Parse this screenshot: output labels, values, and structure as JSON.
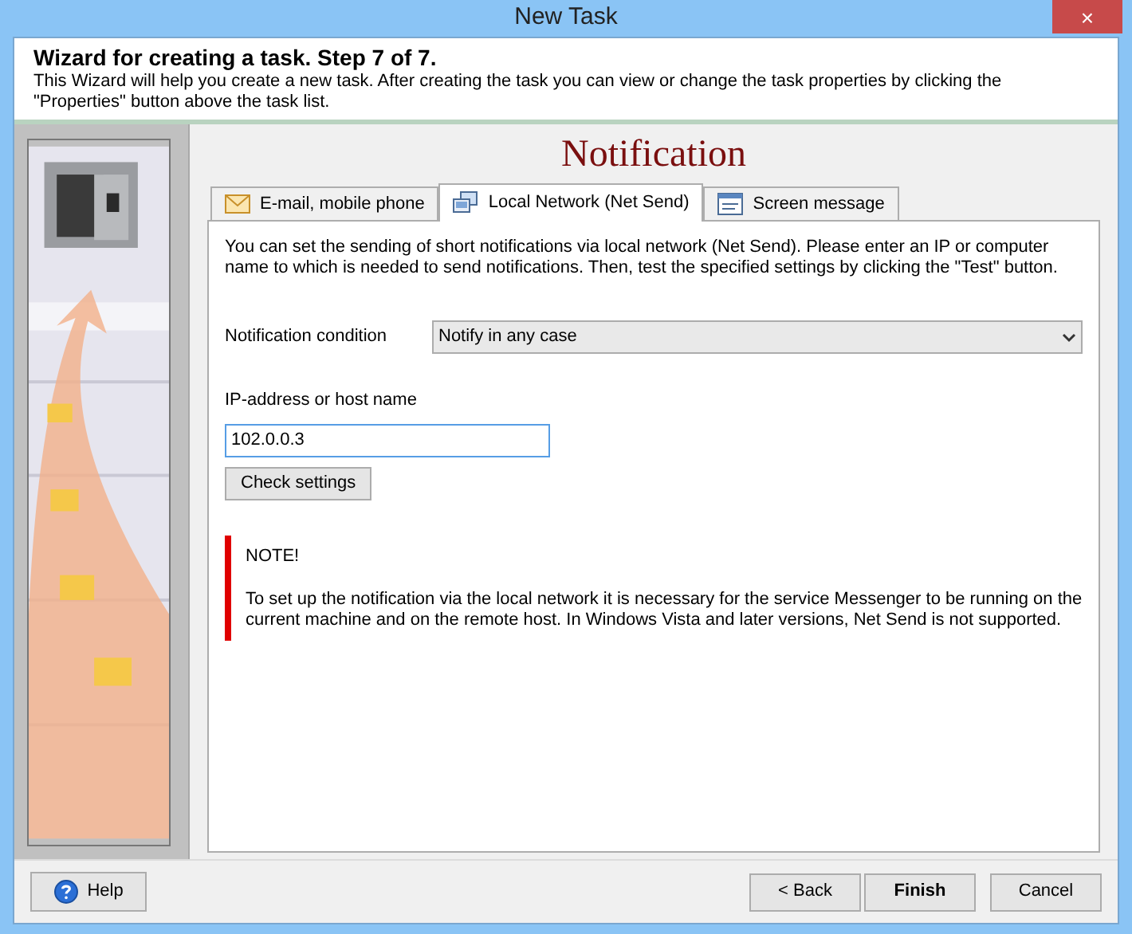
{
  "window": {
    "title": "New Task",
    "close": "×"
  },
  "header": {
    "title": "Wizard for creating a task. Step 7 of 7.",
    "description": "This Wizard will help you create a new task. After creating the task you can view or change the task properties by clicking the \"Properties\" button above the task list."
  },
  "page_title": "Notification",
  "tabs": [
    {
      "label": "E-mail, mobile phone",
      "selected": false
    },
    {
      "label": "Local Network (Net Send)",
      "selected": true
    },
    {
      "label": "Screen message",
      "selected": false
    }
  ],
  "intro": "You can set the sending of short notifications via local network (Net Send). Please enter an IP or computer name to which is needed to send notifications. Then, test the specified settings by clicking the \"Test\" button.",
  "condition": {
    "label": "Notification condition",
    "value": "Notify in any case"
  },
  "host": {
    "label": "IP-address or host name",
    "value": "102.0.0.3"
  },
  "check_button": "Check settings",
  "note": {
    "title": "NOTE!",
    "text": "To set up the notification via the local network it is necessary for the service Messenger to be running on the current machine and on the remote host. In Windows Vista and later versions, Net Send is not supported."
  },
  "footer": {
    "help": "Help",
    "buttons": [
      {
        "label": "< Back",
        "default": false
      },
      {
        "label": "Finish",
        "default": true
      },
      {
        "label": "Cancel",
        "default": false
      }
    ]
  }
}
